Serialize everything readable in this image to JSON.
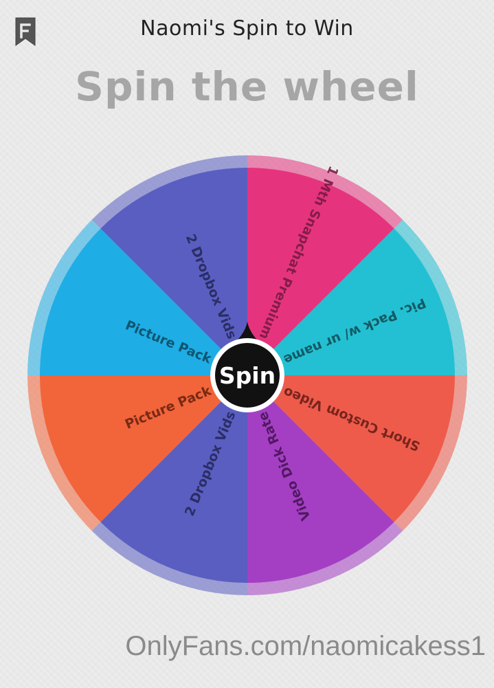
{
  "header": {
    "title": "Naomi's Spin to Win",
    "logo_icon": "bookmark-logo-icon"
  },
  "main": {
    "heading": "Spin the wheel",
    "spin_button": "Spin"
  },
  "wheel": {
    "segments": [
      {
        "label": "1 Mth Snapchat Premium",
        "color": "#e5347d",
        "text_color": "#7a1a44"
      },
      {
        "label": "Pic. Pack w/ ur name",
        "color": "#23c0d3",
        "text_color": "#134f58"
      },
      {
        "label": "Short Custom Video",
        "color": "#ee5b4b",
        "text_color": "#6b1f18"
      },
      {
        "label": "Video Dick Rate",
        "color": "#a43fc4",
        "text_color": "#4a1558"
      },
      {
        "label": "2 Dropbox Vids",
        "color": "#5a5ec1",
        "text_color": "#26295c"
      },
      {
        "label": "Picture Pack",
        "color": "#f2643a",
        "text_color": "#6b2412"
      },
      {
        "label": "Picture Pack",
        "color": "#1fade5",
        "text_color": "#0e4d66"
      },
      {
        "label": "2 Dropbox Vids",
        "color": "#5a5ec1",
        "text_color": "#26295c"
      }
    ]
  },
  "footer": {
    "watermark": "OnlyFans.com/naomicakess1"
  }
}
